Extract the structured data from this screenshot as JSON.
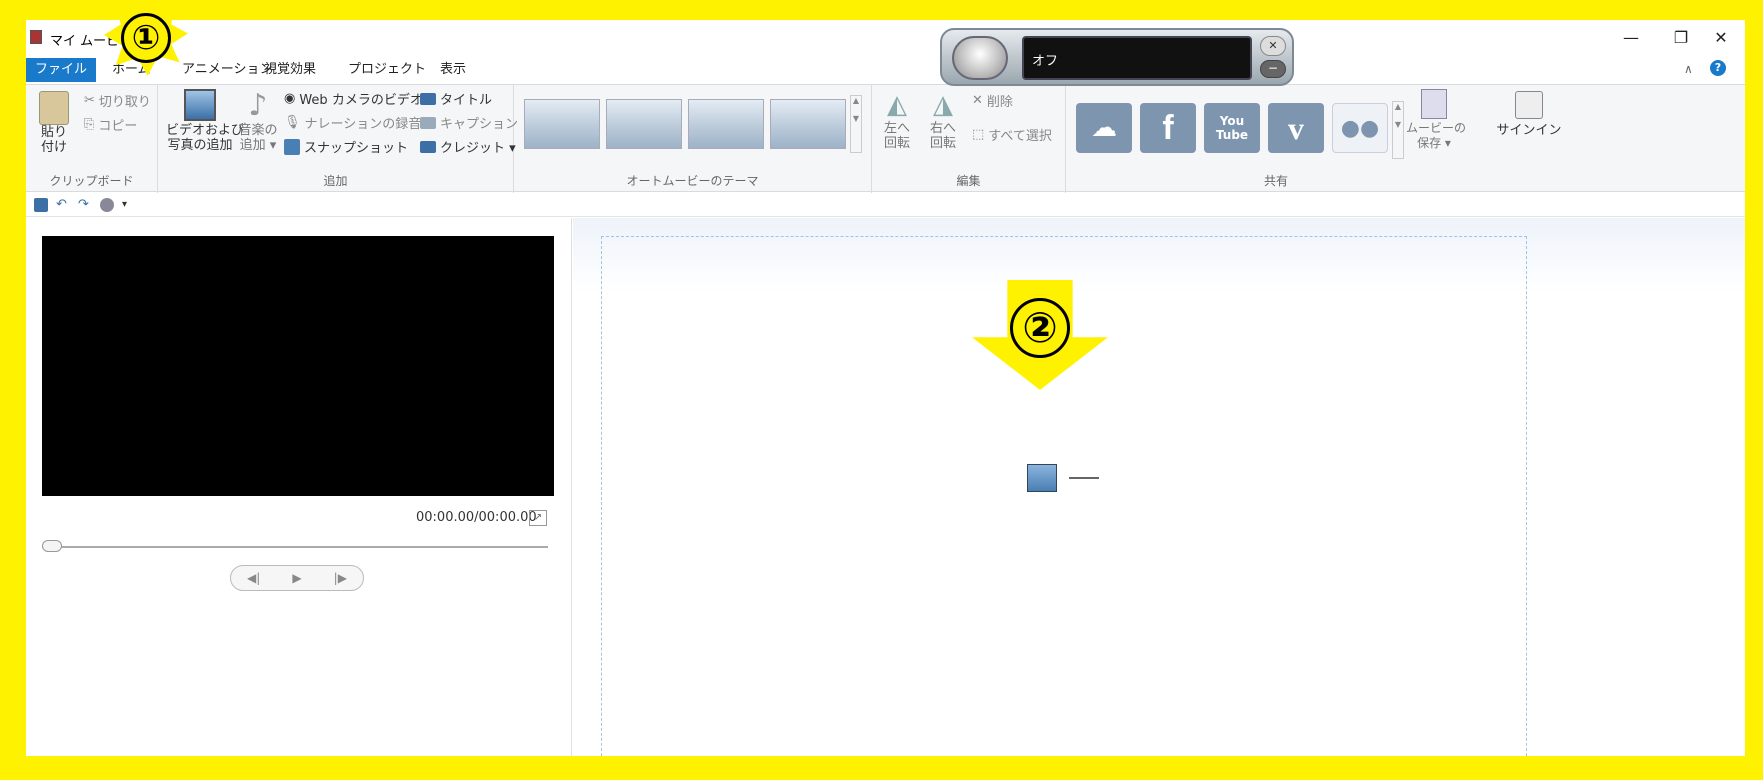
{
  "window": {
    "title": "マイ ムービ",
    "title_rest": "ー",
    "minimize": "—",
    "restore": "❐",
    "close": "✕"
  },
  "tabs": [
    {
      "label": "ファイル"
    },
    {
      "label": "ホーム"
    },
    {
      "label": "アニメーション"
    },
    {
      "label": "視覚効果"
    },
    {
      "label": "プロジェクト"
    },
    {
      "label": "表示"
    }
  ],
  "ribbon": {
    "clipboard": {
      "paste": "貼り\n付け",
      "cut": "切り取り",
      "copy": "コピー",
      "label": "クリップボード"
    },
    "add": {
      "add_video": "ビデオおよび\n写真の追加",
      "add_music": "音楽の\n追加 ▾",
      "webcam": "Web カメラのビデオ",
      "narration": "ナレーションの録音 ▾",
      "snapshot": "スナップショット",
      "title": "タイトル",
      "caption": "キャプション",
      "credits": "クレジット ▾",
      "label": "追加"
    },
    "themes": {
      "label": "オートムービーのテーマ"
    },
    "edit": {
      "rotate_left": "左へ\n回転",
      "rotate_right": "右へ\n回転",
      "delete": "削除",
      "select_all": "すべて選択",
      "label": "編集"
    },
    "share": {
      "youtube": "You\nTube",
      "save_movie": "ムービーの\n保存 ▾",
      "sign_in": "サインイン",
      "label": "共有"
    }
  },
  "preview": {
    "time": "00:00.00/00:00.00",
    "prev_frame": "◀|",
    "play": "▶",
    "next_frame": "|▶"
  },
  "speech": {
    "status": "オフ"
  },
  "annotations": {
    "badge1": "①",
    "badge2": "②"
  },
  "colors": {
    "border": "#fff200",
    "file_tab": "#1979ca",
    "background": "#26398d"
  }
}
